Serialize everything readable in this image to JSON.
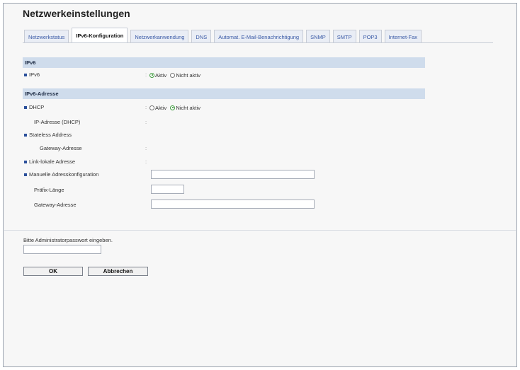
{
  "page": {
    "title": "Netzwerkeinstellungen"
  },
  "tabs": [
    {
      "label": "Netzwerkstatus",
      "active": false
    },
    {
      "label": "IPv6-Konfiguration",
      "active": true
    },
    {
      "label": "Netzwerkanwendung",
      "active": false
    },
    {
      "label": "DNS",
      "active": false
    },
    {
      "label": "Automat. E-Mail-Benachrichtigung",
      "active": false
    },
    {
      "label": "SNMP",
      "active": false
    },
    {
      "label": "SMTP",
      "active": false
    },
    {
      "label": "POP3",
      "active": false
    },
    {
      "label": "Internet-Fax",
      "active": false
    }
  ],
  "ipv6": {
    "header": "IPv6",
    "row_label": "IPv6",
    "options": [
      "Aktiv",
      "Nicht aktiv"
    ],
    "selected": "Aktiv"
  },
  "ipv6_address": {
    "header": "IPv6-Adresse",
    "dhcp_label": "DHCP",
    "dhcp_options": [
      "Aktiv",
      "Nicht aktiv"
    ],
    "dhcp_selected": "Nicht aktiv",
    "ip_dhcp_label": "IP-Adresse (DHCP)",
    "stateless_label": "Stateless Address",
    "gateway_label_1": "Gateway-Adresse",
    "link_local_label": "Link-lokale Adresse",
    "manual_label": "Manuelle Adresskonfiguration",
    "prefix_label": "Präfix-Länge",
    "gateway_label_2": "Gateway-Adresse",
    "manual_value": "",
    "prefix_value": "",
    "gateway_value": ""
  },
  "auth": {
    "prompt": "Bitte Administratorpasswort eingeben.",
    "password_value": ""
  },
  "actions": {
    "ok_label": "OK",
    "cancel_label": "Abbrechen"
  },
  "colors": {
    "section_header_bg": "#cfdcec",
    "bullet": "#2a4f9a",
    "tab_text": "#3a5aa6"
  }
}
